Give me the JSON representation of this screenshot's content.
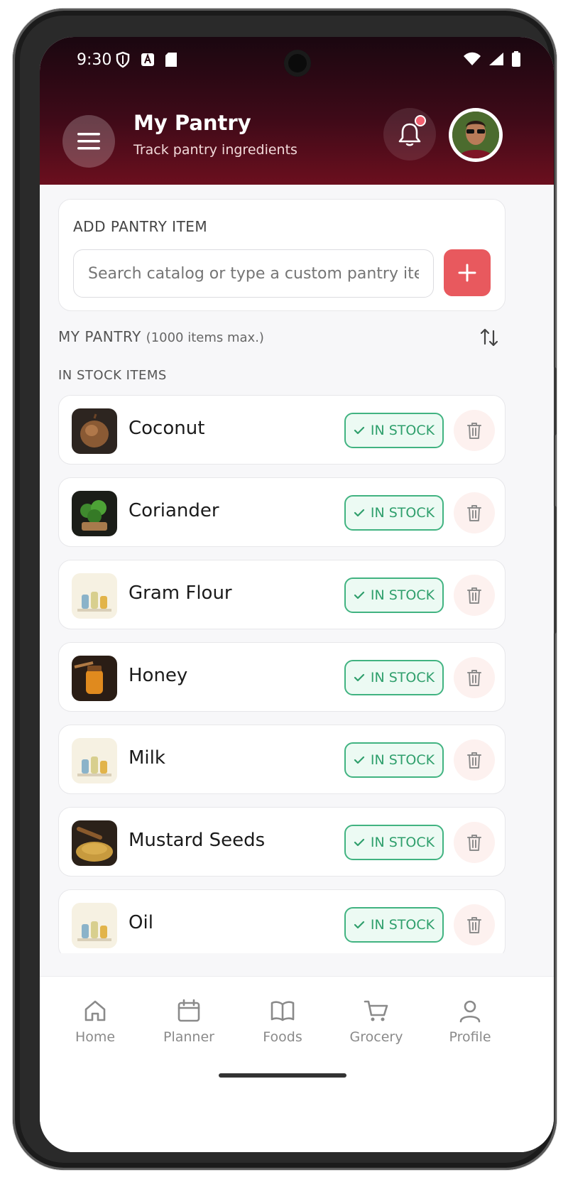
{
  "status_bar": {
    "time": "9:30"
  },
  "header": {
    "title": "My Pantry",
    "subtitle": "Track pantry ingredients"
  },
  "add_section": {
    "label": "ADD PANTRY ITEM",
    "search_placeholder": "Search catalog or type a custom pantry item"
  },
  "pantry": {
    "title": "MY PANTRY",
    "max_note": "(1000 items max.)",
    "in_stock_label": "IN STOCK ITEMS",
    "items": [
      {
        "name": "Coconut",
        "status": "IN STOCK",
        "thumb": "coconut"
      },
      {
        "name": "Coriander",
        "status": "IN STOCK",
        "thumb": "coriander"
      },
      {
        "name": "Gram Flour",
        "status": "IN STOCK",
        "thumb": "jars"
      },
      {
        "name": "Honey",
        "status": "IN STOCK",
        "thumb": "honey"
      },
      {
        "name": "Milk",
        "status": "IN STOCK",
        "thumb": "jars"
      },
      {
        "name": "Mustard Seeds",
        "status": "IN STOCK",
        "thumb": "mustard"
      },
      {
        "name": "Oil",
        "status": "IN STOCK",
        "thumb": "jars"
      }
    ]
  },
  "nav": {
    "items": [
      {
        "label": "Home",
        "icon": "home-icon"
      },
      {
        "label": "Planner",
        "icon": "calendar-icon"
      },
      {
        "label": "Foods",
        "icon": "book-icon"
      },
      {
        "label": "Grocery",
        "icon": "cart-icon"
      },
      {
        "label": "Profile",
        "icon": "person-icon"
      }
    ]
  },
  "colors": {
    "header_dark": "#1a0710",
    "header_red": "#6b0f1e",
    "accent": "#e8595e",
    "stock_green": "#2f9f6c"
  }
}
